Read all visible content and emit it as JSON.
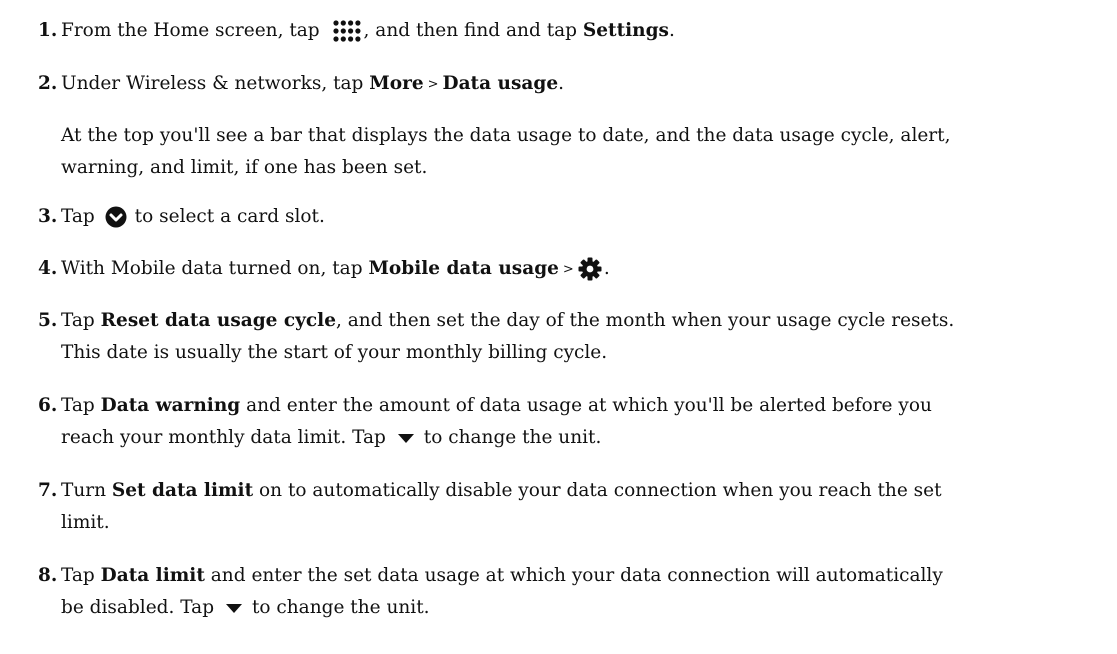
{
  "steps": [
    {
      "num": "1.",
      "p1": "From the Home screen, tap",
      "icon": "apps-grid-icon",
      "p2": ", and then find and tap",
      "b1": "Settings",
      "p3": "."
    },
    {
      "num": "2.",
      "p1": "Under Wireless & networks, tap",
      "b1": "More",
      "sep": ">",
      "b2": "Data usage",
      "p2": "."
    },
    {
      "num": "3.",
      "p1": "Tap",
      "icon": "chevron-circle-down-icon",
      "p2": "to select a card slot."
    },
    {
      "num": "4.",
      "p1": "With Mobile data turned on, tap",
      "b1": "Mobile data usage",
      "sep": ">",
      "icon": "gear-icon",
      "p2": "."
    },
    {
      "num": "5.",
      "p1": "Tap",
      "b1": "Reset data usage cycle",
      "p2": ", and then set the day of the month when your usage cycle resets.",
      "line2": "This date is usually the start of your monthly billing cycle."
    },
    {
      "num": "6.",
      "p1": "Tap",
      "b1": "Data warning",
      "p2": "and enter the amount of data usage at which you'll be alerted before you",
      "line2a": "reach your monthly data limit. Tap",
      "icon": "triangle-down-icon",
      "line2b": "to change the unit."
    },
    {
      "num": "7.",
      "p1": "Turn",
      "b1": "Set data limit",
      "p2": "on to automatically disable your data connection when you reach the set",
      "line2": "limit."
    },
    {
      "num": "8.",
      "p1": "Tap",
      "b1": "Data limit",
      "p2": "and enter the set data usage at which your data connection will automatically",
      "line2a": "be disabled. Tap",
      "icon": "triangle-down-icon",
      "line2b": "to change the unit."
    }
  ],
  "note": {
    "line1": "At the top you'll see a bar that displays the data usage to date, and the data usage cycle, alert,",
    "line2": "warning, and limit, if one has been set."
  }
}
